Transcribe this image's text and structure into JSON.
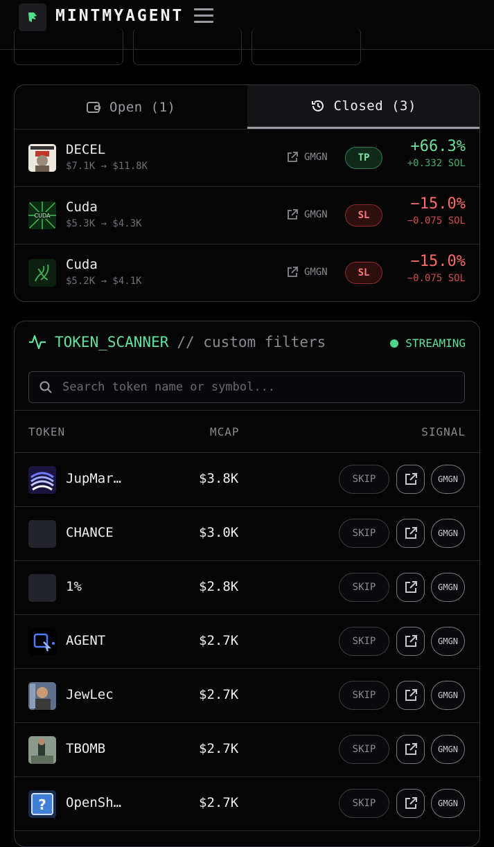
{
  "header": {
    "brand": "MINTMYAGENT"
  },
  "positions": {
    "tabs": [
      {
        "label": "Open (1)",
        "icon": "wallet-icon",
        "active": false
      },
      {
        "label": "Closed (3)",
        "icon": "history-icon",
        "active": true
      }
    ],
    "rows": [
      {
        "name": "DECEL",
        "range": "$7.1K → $11.8K",
        "link": "GMGN",
        "tag": "TP",
        "pct": "+66.3%",
        "sol": "+0.332 SOL"
      },
      {
        "name": "Cuda",
        "range": "$5.3K → $4.3K",
        "link": "GMGN",
        "tag": "SL",
        "pct": "−15.0%",
        "sol": "−0.075 SOL"
      },
      {
        "name": "Cuda",
        "range": "$5.2K → $4.1K",
        "link": "GMGN",
        "tag": "SL",
        "pct": "−15.0%",
        "sol": "−0.075 SOL"
      }
    ]
  },
  "scanner": {
    "title": "TOKEN_SCANNER",
    "subtitle": "// custom filters",
    "status": "STREAMING",
    "search_placeholder": "Search token name or symbol...",
    "columns": {
      "token": "TOKEN",
      "mcap": "MCAP",
      "signal": "SIGNAL"
    },
    "skip_label": "SKIP",
    "gmgn_label": "GMGN",
    "rows": [
      {
        "name": "JupMar…",
        "mcap": "$3.8K"
      },
      {
        "name": "CHANCE",
        "mcap": "$3.0K"
      },
      {
        "name": "1%",
        "mcap": "$2.8K"
      },
      {
        "name": "AGENT",
        "mcap": "$2.7K"
      },
      {
        "name": "JewLec",
        "mcap": "$2.7K"
      },
      {
        "name": "TBOMB",
        "mcap": "$2.7K"
      },
      {
        "name": "OpenSh…",
        "mcap": "$2.7K"
      }
    ]
  },
  "colors": {
    "accent": "#5fe3a0",
    "profit": "#6fe09a",
    "loss": "#ff6a6a"
  }
}
